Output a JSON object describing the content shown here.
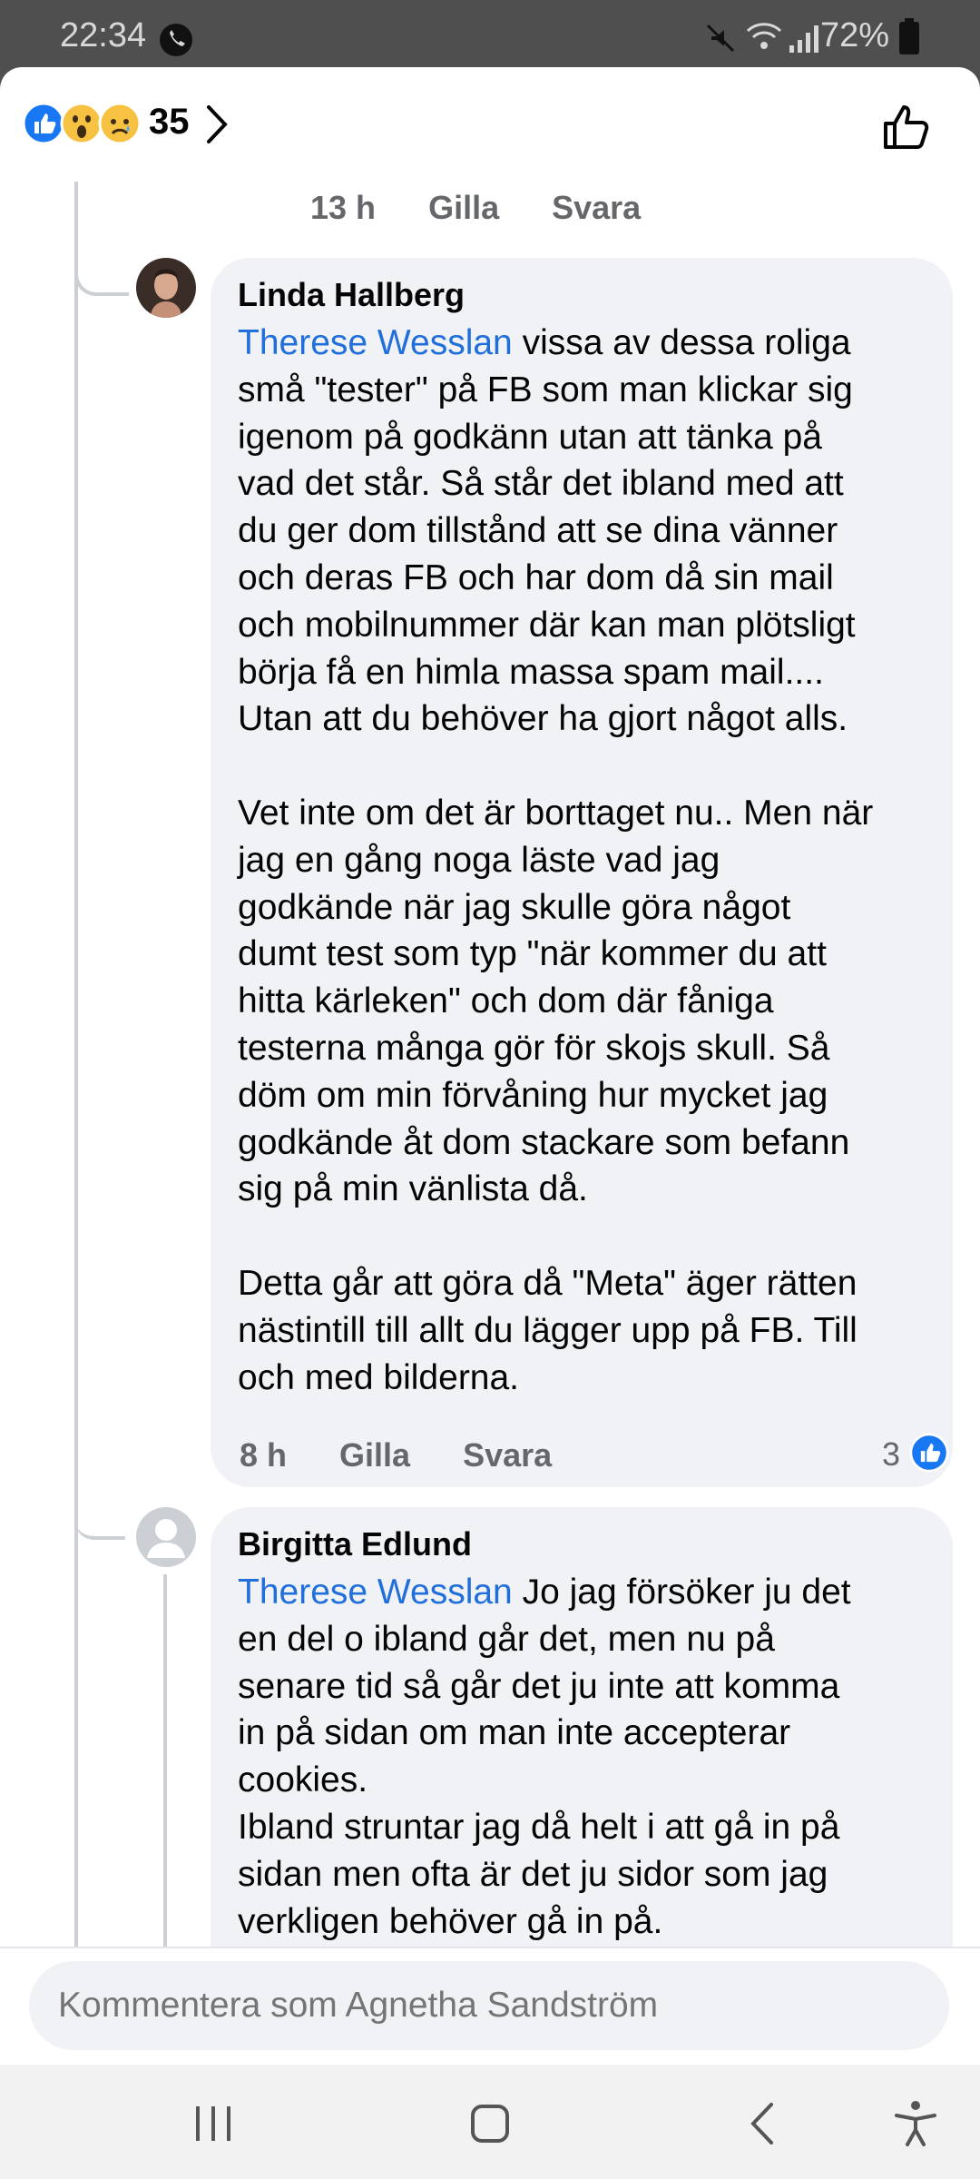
{
  "status": {
    "time": "22:34",
    "battery": "72%"
  },
  "header": {
    "reactions": [
      "like",
      "wow",
      "sad"
    ],
    "count": "35"
  },
  "comments": [
    {
      "meta": {
        "time": "13 h",
        "like": "Gilla",
        "reply": "Svara"
      }
    },
    {
      "author": "Linda Hallberg",
      "mention": "Therese Wesslan",
      "text": " vissa av dessa roliga\nsmå \"tester\" på FB som man klickar sig\nigenom på godkänn utan att tänka på\nvad det står. Så står det ibland med att\ndu ger dom tillstånd att se dina vänner\noch deras FB och har dom då sin mail\noch mobilnummer där kan man plötsligt\nbörja få en himla massa spam mail....\nUtan att du behöver ha gjort något alls.\n\nVet inte om det är borttaget nu.. Men när\njag en gång noga läste vad jag\ngodkände när jag skulle göra något\ndumt test som typ \"när kommer du att\nhitta kärleken\" och dom där fåniga\ntesterna många gör för skojs skull. Så\ndöm om min förvåning hur mycket jag\ngodkände åt dom stackare som befann\nsig på min vänlista då.\n\nDetta går att göra då \"Meta\" äger rätten\nnästintill till allt du lägger upp på FB. Till\noch med bilderna.",
      "meta": {
        "time": "8 h",
        "like": "Gilla",
        "reply": "Svara",
        "reactions": "3"
      }
    },
    {
      "author": "Birgitta Edlund",
      "mention": "Therese Wesslan",
      "text": " Jo jag försöker ju det\nen del o ibland går det, men nu på\nsenare tid så går det ju inte att komma\nin på sidan om man inte accepterar\ncookies.\nIbland struntar jag då helt i att gå in på\nsidan men ofta är det ju sidor som jag\nverkligen behöver gå in på."
    }
  ],
  "comment_bar": {
    "placeholder": "Kommentera som Agnetha Sandström"
  },
  "navbar": {
    "icons": [
      "recent-apps-icon",
      "home-icon",
      "back-icon",
      "accessibility-icon"
    ]
  }
}
